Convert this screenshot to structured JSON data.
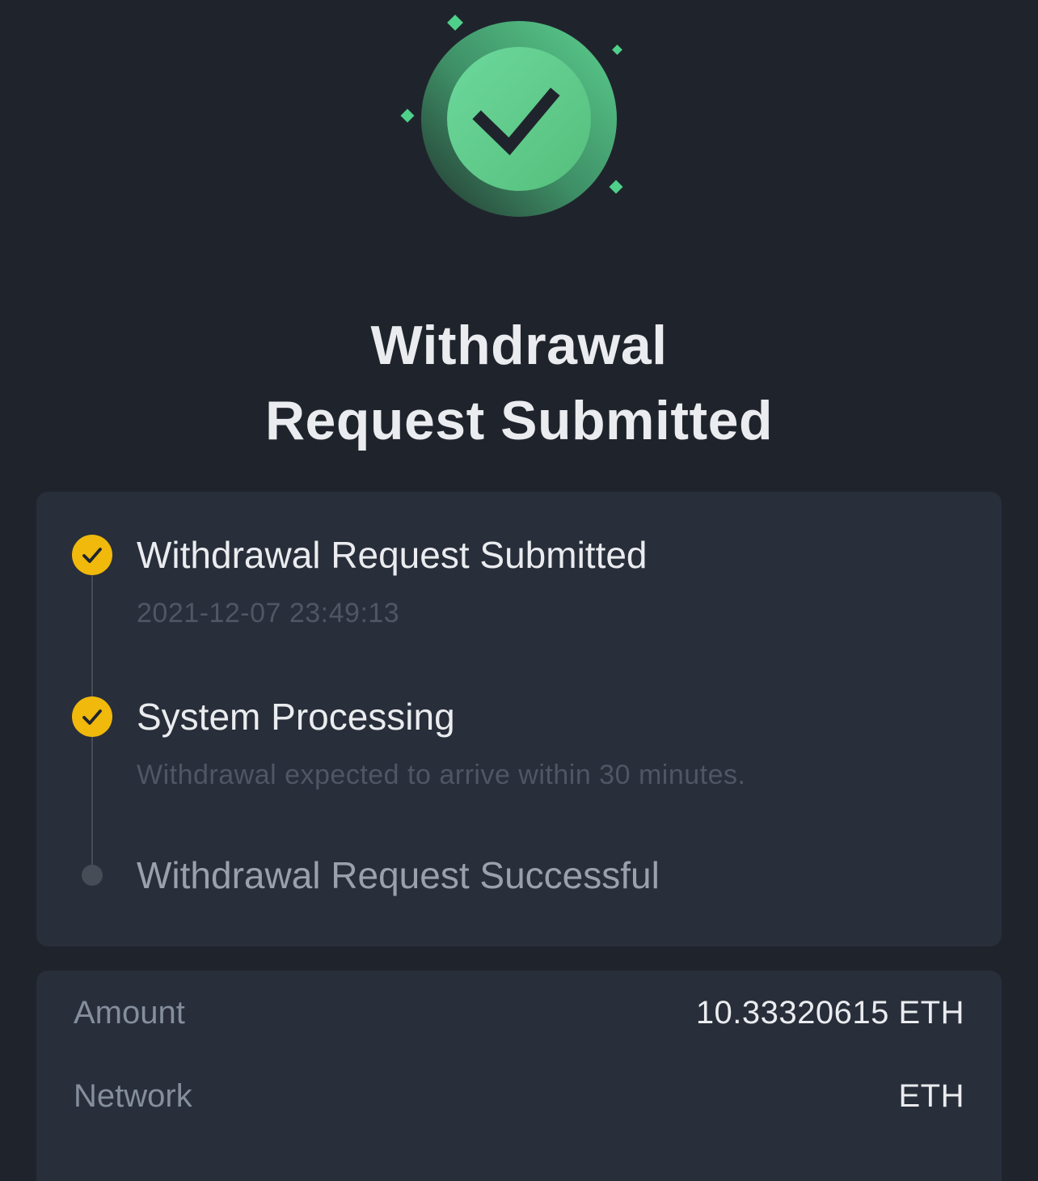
{
  "header": {
    "title_line1": "Withdrawal",
    "title_line2": "Request Submitted",
    "icon": "success-check-icon",
    "colors": {
      "success": "#5bc586",
      "sparkle": "#4fd08a",
      "background": "#1f242c"
    }
  },
  "timeline": {
    "colors": {
      "completed": "#f0b90b",
      "pending": "#474d57"
    },
    "steps": [
      {
        "title": "Withdrawal Request Submitted",
        "subtitle": "2021-12-07 23:49:13",
        "status": "completed",
        "icon": "check-circle-icon"
      },
      {
        "title": "System Processing",
        "subtitle": "Withdrawal expected to arrive within 30 minutes.",
        "status": "completed",
        "icon": "check-circle-icon"
      },
      {
        "title": "Withdrawal Request Successful",
        "status": "pending",
        "icon": "dot-icon"
      }
    ]
  },
  "details": {
    "rows": [
      {
        "label": "Amount",
        "value": "10.33320615 ETH"
      },
      {
        "label": "Network",
        "value": "ETH"
      }
    ]
  }
}
